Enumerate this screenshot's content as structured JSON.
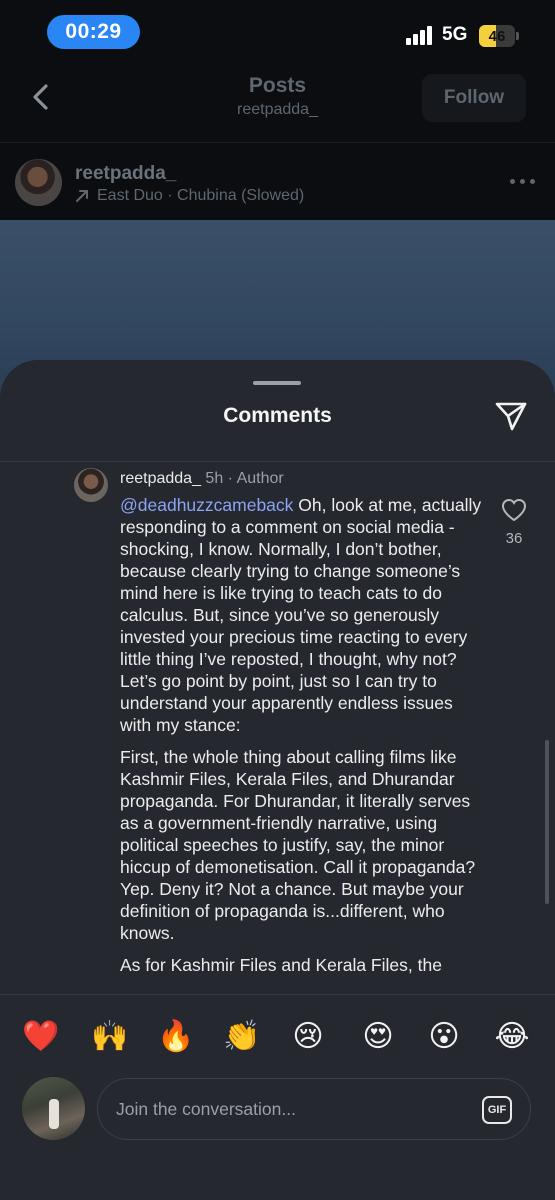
{
  "status_bar": {
    "time": "00:29",
    "network": "5G",
    "battery": "46",
    "battery_level": 0.46,
    "time_pill_color": "#2a86f5",
    "battery_color": "#f4d13c"
  },
  "header": {
    "title": "Posts",
    "subtitle": "reetpadda_",
    "follow_label": "Follow",
    "back_icon": "chevron-left-icon"
  },
  "post": {
    "username": "reetpadda_",
    "music": "East Duo · Chubina (Slowed)",
    "music_icon": "arrow-up-right-icon",
    "more_icon": "more-horizontal-icon"
  },
  "comments_sheet": {
    "title": "Comments",
    "share_icon": "send-icon",
    "comment": {
      "username": "reetpadda_",
      "time": "5h",
      "separator": "·",
      "role": "Author",
      "mention": "@deadhuzzcameback",
      "paragraph_1": "Oh, look at me, actually responding to a comment on social media - shocking, I know. Normally, I don’t bother, because clearly trying to change someone’s mind here is like trying to teach cats to do calculus. But, since you’ve so generously invested your precious time reacting to every little thing I’ve reposted, I thought, why not? Let’s go point by point, just so I can try to understand your apparently endless issues with my stance:",
      "paragraph_2": "First, the whole thing about calling films like Kashmir Files, Kerala Files, and Dhurandar propaganda. For Dhurandar, it literally serves as a government-friendly narrative, using political speeches to justify, say, the minor hiccup of demonetisation. Call it propaganda? Yep. Deny it? Not a chance. But maybe your definition of propaganda is...different, who knows.",
      "paragraph_3": "As for Kashmir Files and Kerala Files, the",
      "like_count": "36",
      "like_icon": "heart-outline-icon"
    }
  },
  "emoji_reactions": [
    "❤️",
    "🙌",
    "🔥",
    "👏",
    "😢",
    "😍",
    "😮",
    "😂"
  ],
  "composer": {
    "placeholder": "Join the conversation...",
    "gif_label": "GIF"
  }
}
